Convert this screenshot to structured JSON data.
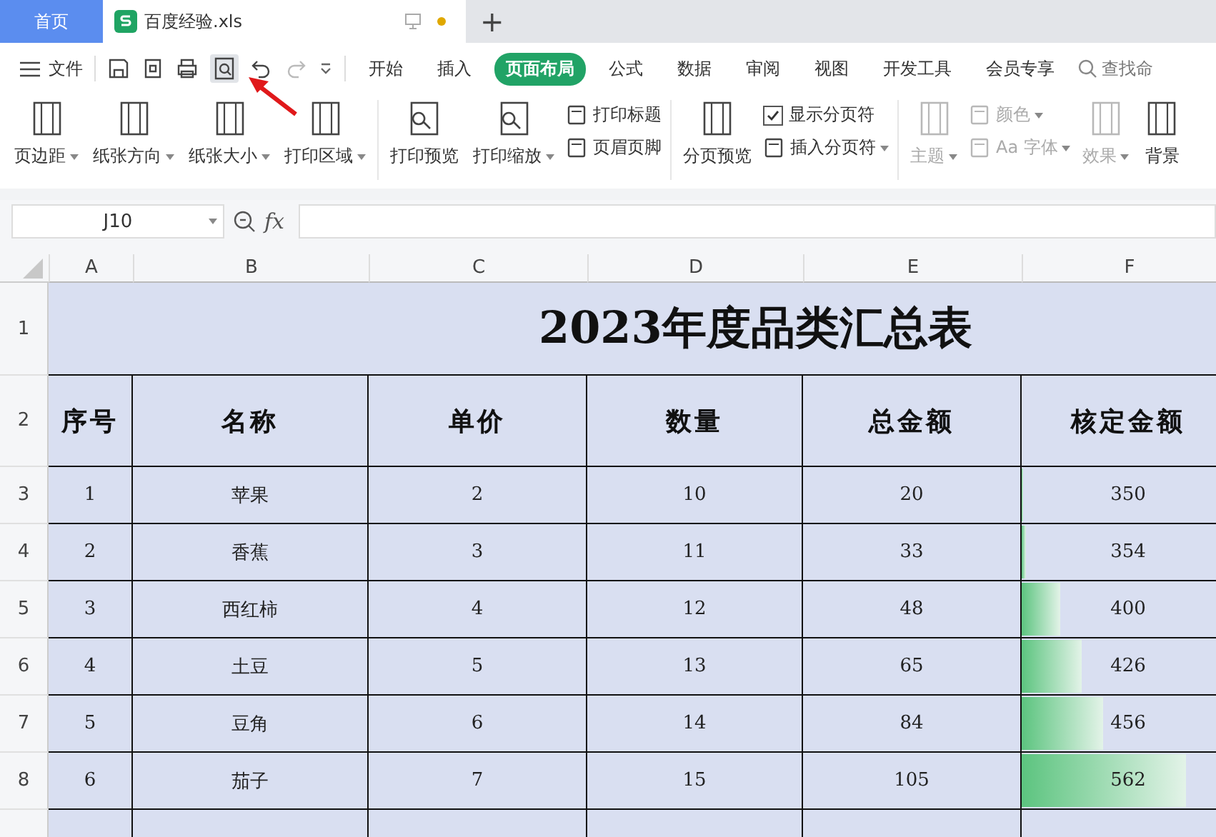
{
  "doc_tabs": [
    {
      "label": "首页",
      "kind": "home",
      "selected": false
    },
    {
      "label": "百度经验.xls",
      "kind": "file",
      "selected": true
    }
  ],
  "new_tab": "+",
  "menu": {
    "file_label": "文件",
    "tabs": [
      {
        "label": "开始",
        "selected": false
      },
      {
        "label": "插入",
        "selected": false
      },
      {
        "label": "页面布局",
        "selected": true
      },
      {
        "label": "公式",
        "selected": false
      },
      {
        "label": "数据",
        "selected": false
      },
      {
        "label": "审阅",
        "selected": false
      },
      {
        "label": "视图",
        "selected": false
      },
      {
        "label": "开发工具",
        "selected": false
      },
      {
        "label": "会员专享",
        "selected": false
      }
    ],
    "search_placeholder": "查找命"
  },
  "ribbon": [
    [
      {
        "kind": "big",
        "label": "页边距",
        "dropdown": true,
        "disabled": false
      },
      {
        "kind": "big",
        "label": "纸张方向",
        "dropdown": true,
        "disabled": false
      },
      {
        "kind": "big",
        "label": "纸张大小",
        "dropdown": true,
        "disabled": false
      },
      {
        "kind": "big",
        "label": "打印区域",
        "dropdown": true,
        "disabled": false
      }
    ],
    [
      {
        "kind": "big",
        "label": "打印预览",
        "dropdown": false,
        "disabled": false
      },
      {
        "kind": "big",
        "label": "打印缩放",
        "dropdown": true,
        "disabled": false
      },
      {
        "kind": "stack",
        "rows": [
          {
            "kind": "small",
            "label": "打印标题",
            "dropdown": false,
            "disabled": false
          },
          {
            "kind": "small",
            "label": "页眉页脚",
            "dropdown": false,
            "disabled": false
          }
        ]
      }
    ],
    [
      {
        "kind": "big",
        "label": "分页预览",
        "dropdown": false,
        "disabled": false
      },
      {
        "kind": "stack",
        "rows": [
          {
            "kind": "check",
            "label": "显示分页符",
            "checked": true,
            "disabled": false
          },
          {
            "kind": "small",
            "label": "插入分页符",
            "dropdown": true,
            "disabled": false
          }
        ]
      }
    ],
    [
      {
        "kind": "big",
        "label": "主题",
        "dropdown": true,
        "disabled": true
      },
      {
        "kind": "stack",
        "rows": [
          {
            "kind": "small",
            "label": "颜色",
            "dropdown": true,
            "disabled": true
          },
          {
            "kind": "small",
            "label": "Aa 字体",
            "dropdown": true,
            "disabled": true
          }
        ]
      },
      {
        "kind": "big",
        "label": "效果",
        "dropdown": true,
        "disabled": true
      },
      {
        "kind": "big",
        "label": "背景",
        "dropdown": false,
        "disabled": false
      }
    ]
  ],
  "formula_bar": {
    "name_box": "J10",
    "fx": "fx"
  },
  "sheet": {
    "columns": [
      "A",
      "B",
      "C",
      "D",
      "E",
      "F"
    ],
    "row_numbers": [
      "1",
      "2",
      "3",
      "4",
      "5",
      "6",
      "7",
      "8"
    ],
    "title": "2023年度品类汇总表",
    "headers": [
      "序号",
      "名称",
      "单价",
      "数量",
      "总金额",
      "核定金额"
    ],
    "rows": [
      {
        "cells": [
          "1",
          "苹果",
          "2",
          "10",
          "20",
          "350"
        ],
        "level": 0
      },
      {
        "cells": [
          "2",
          "香蕉",
          "3",
          "11",
          "33",
          "354"
        ],
        "level": 0.02
      },
      {
        "cells": [
          "3",
          "西红柿",
          "4",
          "12",
          "48",
          "400"
        ],
        "level": 0.18
      },
      {
        "cells": [
          "4",
          "土豆",
          "5",
          "13",
          "65",
          "426"
        ],
        "level": 0.28
      },
      {
        "cells": [
          "5",
          "豆角",
          "6",
          "14",
          "84",
          "456"
        ],
        "level": 0.38
      },
      {
        "cells": [
          "6",
          "茄子",
          "7",
          "15",
          "105",
          "562"
        ],
        "level": 0.77
      }
    ]
  }
}
